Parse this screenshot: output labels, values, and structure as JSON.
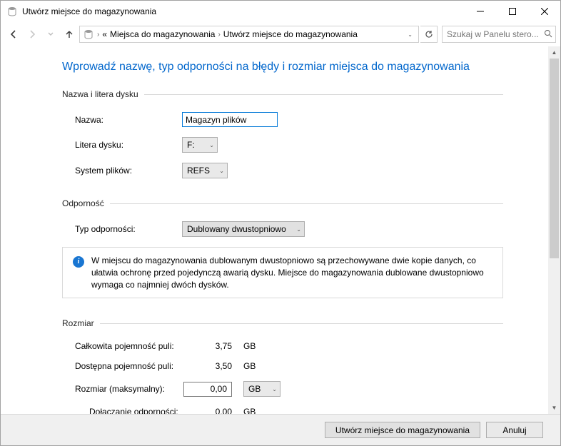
{
  "window": {
    "title": "Utwórz miejsce do magazynowania"
  },
  "breadcrumb": {
    "prefix": "«",
    "item1": "Miejsca do magazynowania",
    "item2": "Utwórz miejsce do magazynowania"
  },
  "search": {
    "placeholder": "Szukaj w Panelu stero..."
  },
  "heading": "Wprowadź nazwę, typ odporności na błędy i rozmiar miejsca do magazynowania",
  "section_name": {
    "legend": "Nazwa i litera dysku",
    "name_label": "Nazwa:",
    "name_value": "Magazyn plików",
    "drive_label": "Litera dysku:",
    "drive_value": "F:",
    "fs_label": "System plików:",
    "fs_value": "REFS"
  },
  "section_resil": {
    "legend": "Odporność",
    "type_label": "Typ odporności:",
    "type_value": "Dublowany dwustopniowo",
    "info": "W miejscu do magazynowania dublowanym dwustopniowo są przechowywane dwie kopie danych, co ułatwia ochronę przed pojedynczą awarią dysku. Miejsce do magazynowania dublowane dwustopniowo wymaga co najmniej dwóch dysków."
  },
  "section_size": {
    "legend": "Rozmiar",
    "total_label": "Całkowita pojemność puli:",
    "total_value": "3,75",
    "total_unit": "GB",
    "avail_label": "Dostępna pojemność puli:",
    "avail_value": "3,50",
    "avail_unit": "GB",
    "max_label": "Rozmiar (maksymalny):",
    "max_value": "0,00",
    "max_unit": "GB",
    "resil_label": "Dołączanie odporności:",
    "resil_value": "0,00",
    "resil_unit": "GB"
  },
  "footer": {
    "create": "Utwórz miejsce do magazynowania",
    "cancel": "Anuluj"
  }
}
